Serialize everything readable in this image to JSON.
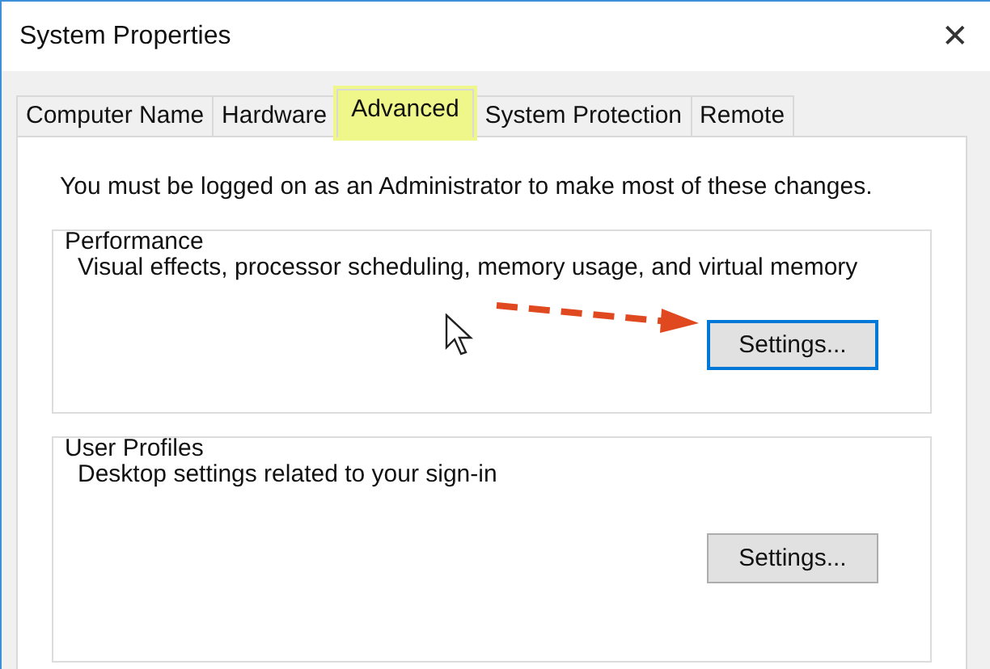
{
  "window": {
    "title": "System Properties",
    "close": "✕"
  },
  "tabs": [
    {
      "label": "Computer Name",
      "selected": false,
      "highlighted": false
    },
    {
      "label": "Hardware",
      "selected": false,
      "highlighted": false
    },
    {
      "label": "Advanced",
      "selected": true,
      "highlighted": true
    },
    {
      "label": "System Protection",
      "selected": false,
      "highlighted": false
    },
    {
      "label": "Remote",
      "selected": false,
      "highlighted": false
    }
  ],
  "notice": "You must be logged on as an Administrator to make most of these changes.",
  "groups": [
    {
      "title": "Performance",
      "description": "Visual effects, processor scheduling, memory usage, and virtual memory",
      "button": {
        "label": "Settings...",
        "focused": true
      },
      "annotation": {
        "kind": "arrow"
      }
    },
    {
      "title": "User Profiles",
      "description": "Desktop settings related to your sign-in",
      "button": {
        "label": "Settings...",
        "focused": false
      }
    }
  ]
}
